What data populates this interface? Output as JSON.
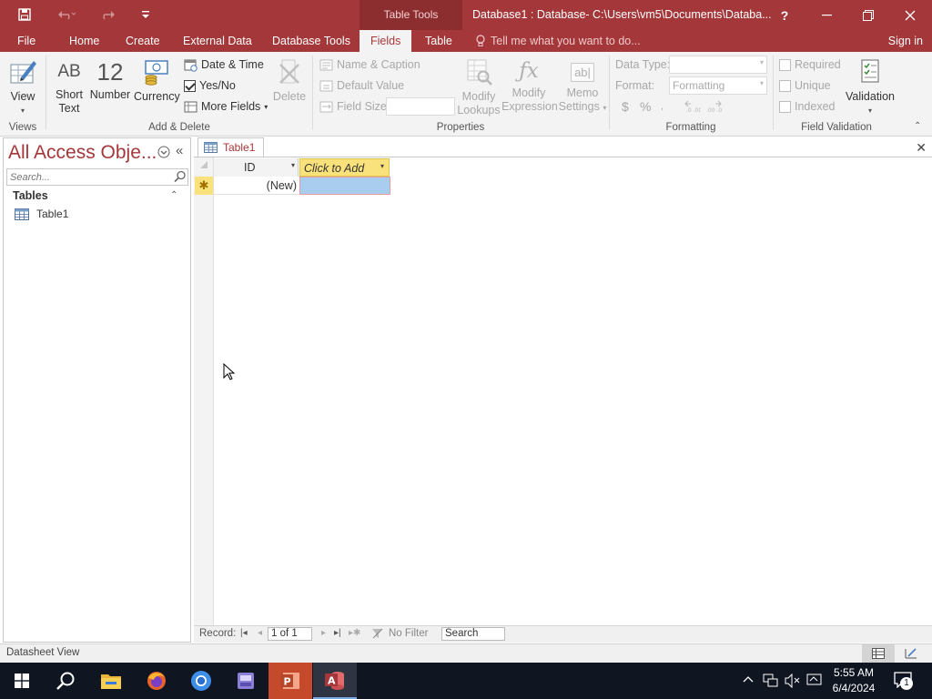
{
  "title_bar": {
    "contextual_tab_group": "Table Tools",
    "document_title": "Database1 : Database- C:\\Users\\vm5\\Documents\\Databa...",
    "help_label": "?"
  },
  "ribbon_tabs": [
    "File",
    "Home",
    "Create",
    "External Data",
    "Database Tools",
    "Fields",
    "Table"
  ],
  "active_tab": "Fields",
  "tell_me_placeholder": "Tell me what you want to do...",
  "sign_in": "Sign in",
  "ribbon": {
    "views": {
      "view_label": "View",
      "group_label": "Views"
    },
    "add_delete": {
      "short_text": [
        "Short",
        "Text"
      ],
      "short_text_glyph": "AB",
      "number": "Number",
      "number_glyph": "12",
      "currency": "Currency",
      "date_time": "Date & Time",
      "yes_no": "Yes/No",
      "more_fields": "More Fields",
      "delete": "Delete",
      "group_label": "Add & Delete"
    },
    "properties": {
      "name_caption": "Name & Caption",
      "default_value": "Default Value",
      "field_size": "Field Size",
      "modify_lookups": [
        "Modify",
        "Lookups"
      ],
      "modify_expression": [
        "Modify",
        "Expression"
      ],
      "memo_settings": [
        "Memo",
        "Settings"
      ],
      "memo_glyph": "ab|",
      "group_label": "Properties"
    },
    "formatting": {
      "data_type_label": "Data Type:",
      "format_label": "Format:",
      "format_value": "Formatting",
      "currency_symbol": "$",
      "percent_symbol": "%",
      "group_label": "Formatting"
    },
    "field_validation": {
      "required": "Required",
      "unique": "Unique",
      "indexed": "Indexed",
      "validation": "Validation",
      "group_label": "Field Validation"
    }
  },
  "nav_pane": {
    "title": "All Access Obje...",
    "search_placeholder": "Search...",
    "section": "Tables",
    "items": [
      "Table1"
    ]
  },
  "document": {
    "tab_label": "Table1",
    "columns": [
      "ID",
      "Click to Add"
    ],
    "new_row_value": "(New)"
  },
  "record_nav": {
    "label": "Record:",
    "position": "1 of 1",
    "filter": "No Filter",
    "search_value": "Search"
  },
  "status": {
    "view_name": "Datasheet View"
  },
  "taskbar": {
    "time": "5:55 AM",
    "date": "6/4/2024",
    "notification_count": "1"
  }
}
